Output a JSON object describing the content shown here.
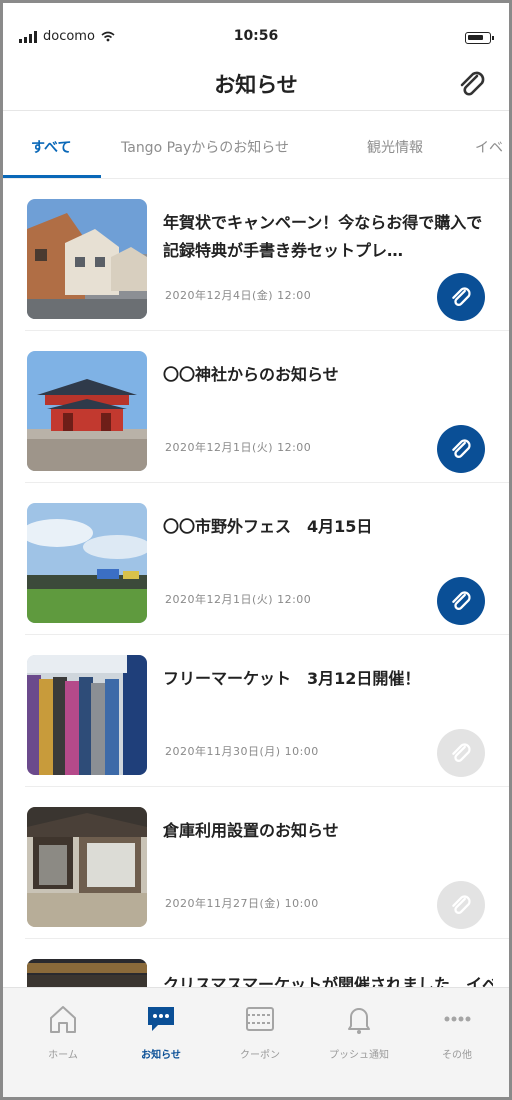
{
  "status_bar": {
    "carrier": "docomo",
    "time": "10:56"
  },
  "header": {
    "title": "お知らせ",
    "clip_icon": "paperclip-icon"
  },
  "tabs": [
    {
      "label": "すべて",
      "active": true
    },
    {
      "label": "Tango Payからのお知らせ",
      "active": false
    },
    {
      "label": "観光情報",
      "active": false
    },
    {
      "label": "イベ",
      "active": false
    }
  ],
  "notices": [
    {
      "title": "年賀状でキャンペーン！今ならお得で購入で記録特典が手書き券セットプレ…",
      "date": "2020年12月4日(金) 12:00",
      "clipped": true
    },
    {
      "title": "〇〇神社からのお知らせ",
      "date": "2020年12月1日(火) 12:00",
      "clipped": true
    },
    {
      "title": "〇〇市野外フェス　4月15日",
      "date": "2020年12月1日(火) 12:00",
      "clipped": true
    },
    {
      "title": "フリーマーケット　3月12日開催！",
      "date": "2020年11月30日(月) 10:00",
      "clipped": false
    },
    {
      "title": "倉庫利用設置のお知らせ",
      "date": "2020年11月27日(金) 10:00",
      "clipped": false
    },
    {
      "title": "クリスマスマーケットが開催されました　イベ",
      "date": "",
      "clipped": false
    }
  ],
  "tab_bar": [
    {
      "label": "ホーム",
      "icon": "home-icon",
      "active": false
    },
    {
      "label": "お知らせ",
      "icon": "notice-chat-icon",
      "active": true
    },
    {
      "label": "クーポン",
      "icon": "coupon-icon",
      "active": false
    },
    {
      "label": "プッシュ通知",
      "icon": "bell-icon",
      "active": false
    },
    {
      "label": "その他",
      "icon": "more-icon",
      "active": false
    }
  ],
  "colors": {
    "accent": "#0a68b8",
    "clip_active": "#0a4f96",
    "clip_inactive": "#e3e3e3"
  }
}
